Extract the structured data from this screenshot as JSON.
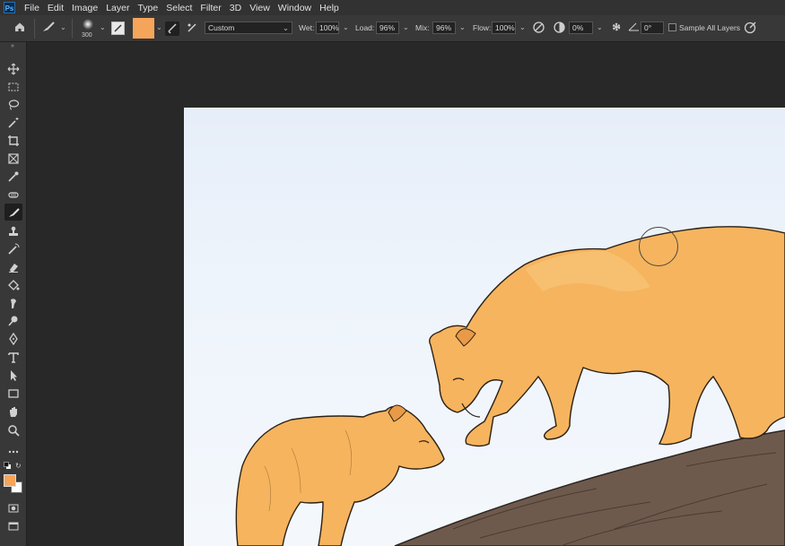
{
  "app": {
    "logo": "Ps"
  },
  "menu": [
    "File",
    "Edit",
    "Image",
    "Layer",
    "Type",
    "Select",
    "Filter",
    "3D",
    "View",
    "Window",
    "Help"
  ],
  "options": {
    "brush_size": "300",
    "foreground_color": "#f5a55a",
    "preset": "Custom",
    "wet_label": "Wet:",
    "wet_value": "100%",
    "load_label": "Load:",
    "load_value": "96%",
    "mix_label": "Mix:",
    "mix_value": "96%",
    "flow_label": "Flow:",
    "flow_value": "100%",
    "smoothing_value": "0%",
    "angle_value": "0°",
    "sample_all_layers_label": "Sample All Layers"
  },
  "toolbar": {
    "foreground_color": "#f5a55a",
    "background_color": "#ffffff"
  },
  "canvas": {
    "fur_color": "#f6b45e",
    "rock_color": "#6b5548"
  }
}
